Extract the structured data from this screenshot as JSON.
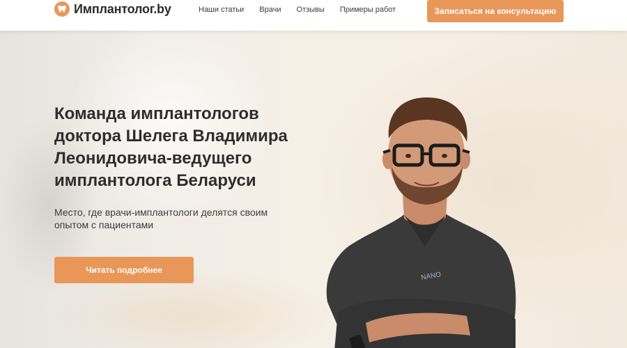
{
  "header": {
    "logo_text": "Имплантолог.by",
    "nav": [
      {
        "label": "Наши статьи"
      },
      {
        "label": "Врачи"
      },
      {
        "label": "Отзывы"
      },
      {
        "label": "Примеры работ"
      }
    ],
    "cta_label": "Записаться на консультацию"
  },
  "hero": {
    "title": "Команда имплантологов доктора Шелега Владимира Леонидовича-ведущего имплантолога Беларуси",
    "subtitle": "Место, где врачи-имплантологи делятся своим опытом с пациентами",
    "cta_label": "Читать подробнее",
    "shirt_brand": "NANO"
  },
  "colors": {
    "accent": "#e99758",
    "text_dark": "#2e2e2e",
    "scrubs": "#3a3a3a"
  },
  "icons": {
    "logo": "tooth-icon"
  }
}
